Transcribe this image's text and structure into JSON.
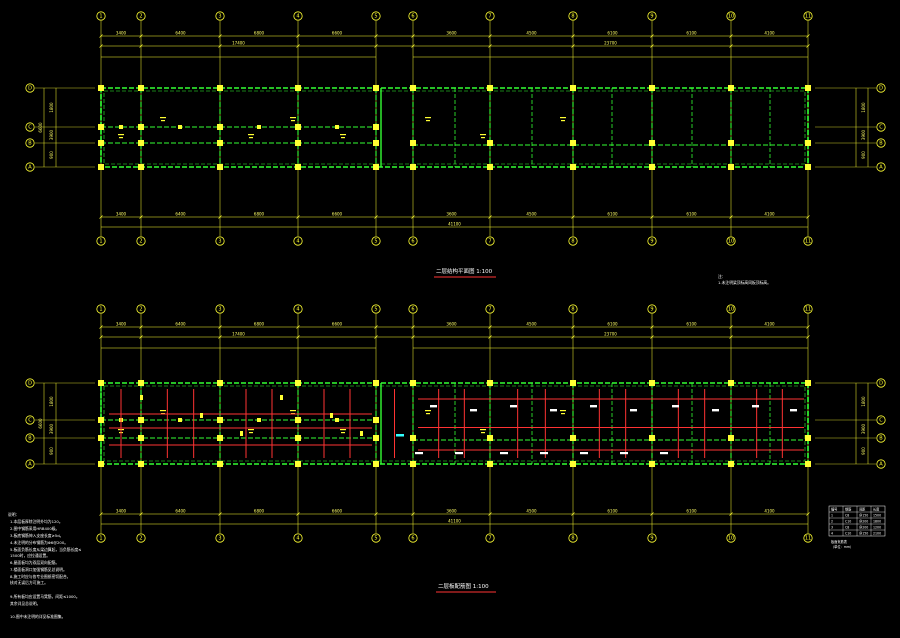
{
  "colors": {
    "background": "#000000",
    "axis": "#ffff33",
    "beam": "#33ff33",
    "column": "#ffff33",
    "rebar": "#ff3333",
    "text": "#ffffff",
    "underline": "#ff3333",
    "accent_cyan": "#33ffff"
  },
  "drawings": [
    {
      "title": "二层结构平面图  1:100",
      "x_axes": [
        "1",
        "2",
        "3",
        "4",
        "5",
        "6",
        "7",
        "8",
        "9",
        "10",
        "11"
      ],
      "y_axes": [
        "D",
        "C",
        "B",
        "A"
      ],
      "dims_top_1": [
        "3400",
        "6400",
        "6800",
        "6600",
        "3600",
        "4500",
        "6100",
        "6100",
        "4100"
      ],
      "dims_top_2": [
        "17400",
        "23700"
      ],
      "dims_bottom_1": [
        "3400",
        "6400",
        "6800",
        "6600",
        "3600",
        "4500",
        "6100",
        "6100",
        "4100"
      ],
      "dims_bottom_2": [
        "41100"
      ],
      "side_dims": [
        "1800",
        "3900",
        "900",
        "6600"
      ],
      "note_head": "注：",
      "note_line": "1.未注明梁顶标高同板顶标高。"
    },
    {
      "title": "二层板配筋图  1:100",
      "x_axes": [
        "1",
        "2",
        "3",
        "4",
        "5",
        "6",
        "7",
        "8",
        "9",
        "10",
        "11"
      ],
      "y_axes": [
        "D",
        "C",
        "B",
        "A"
      ],
      "dims_top_1": [
        "3400",
        "6400",
        "6800",
        "6600",
        "3600",
        "4500",
        "6100",
        "6100",
        "4100"
      ],
      "dims_top_2": [
        "17400",
        "23700"
      ],
      "dims_bottom_1": [
        "3400",
        "6400",
        "6800",
        "6600",
        "3600",
        "4500",
        "6100",
        "6100",
        "4100"
      ],
      "dims_bottom_2": [
        "41100"
      ],
      "side_dims": [
        "1800",
        "3900",
        "900",
        "6600"
      ]
    }
  ],
  "notes": {
    "head": "说明：",
    "lines": [
      "1.本层板厚除注明外均为120。",
      "2.图中钢筋采用HRB400级。",
      "3.板底钢筋伸入支座长度≥5d。",
      "4.未注明的分布钢筋为Φ6@200。",
      "5.板面负筋长度从梁边算起，当负筋长度≤",
      "   1500时，应拉通设置。",
      "6.屋面板均为双层双向配筋。",
      "7.楼面板洞口加强钢筋见总说明。",
      "8.施工时应与各专业图纸密切配合，",
      "   核对无误后方可施工。",
      "9.所有板均应设置马凳筋，间距≤1000。",
      "   其余详见总说明。",
      "10.图中未注明的详见标准图集。"
    ]
  },
  "legend_table": {
    "headers": [
      "编号",
      "钢筋",
      "间距",
      "长度"
    ],
    "rows": [
      [
        "1",
        "C8",
        "@150",
        "1500"
      ],
      [
        "2",
        "C10",
        "@200",
        "1800"
      ],
      [
        "3",
        "C8",
        "@200",
        "1200"
      ],
      [
        "4",
        "C10",
        "@150",
        "2100"
      ]
    ],
    "caption": "板面负筋表",
    "caption2": "（单位：mm）"
  }
}
